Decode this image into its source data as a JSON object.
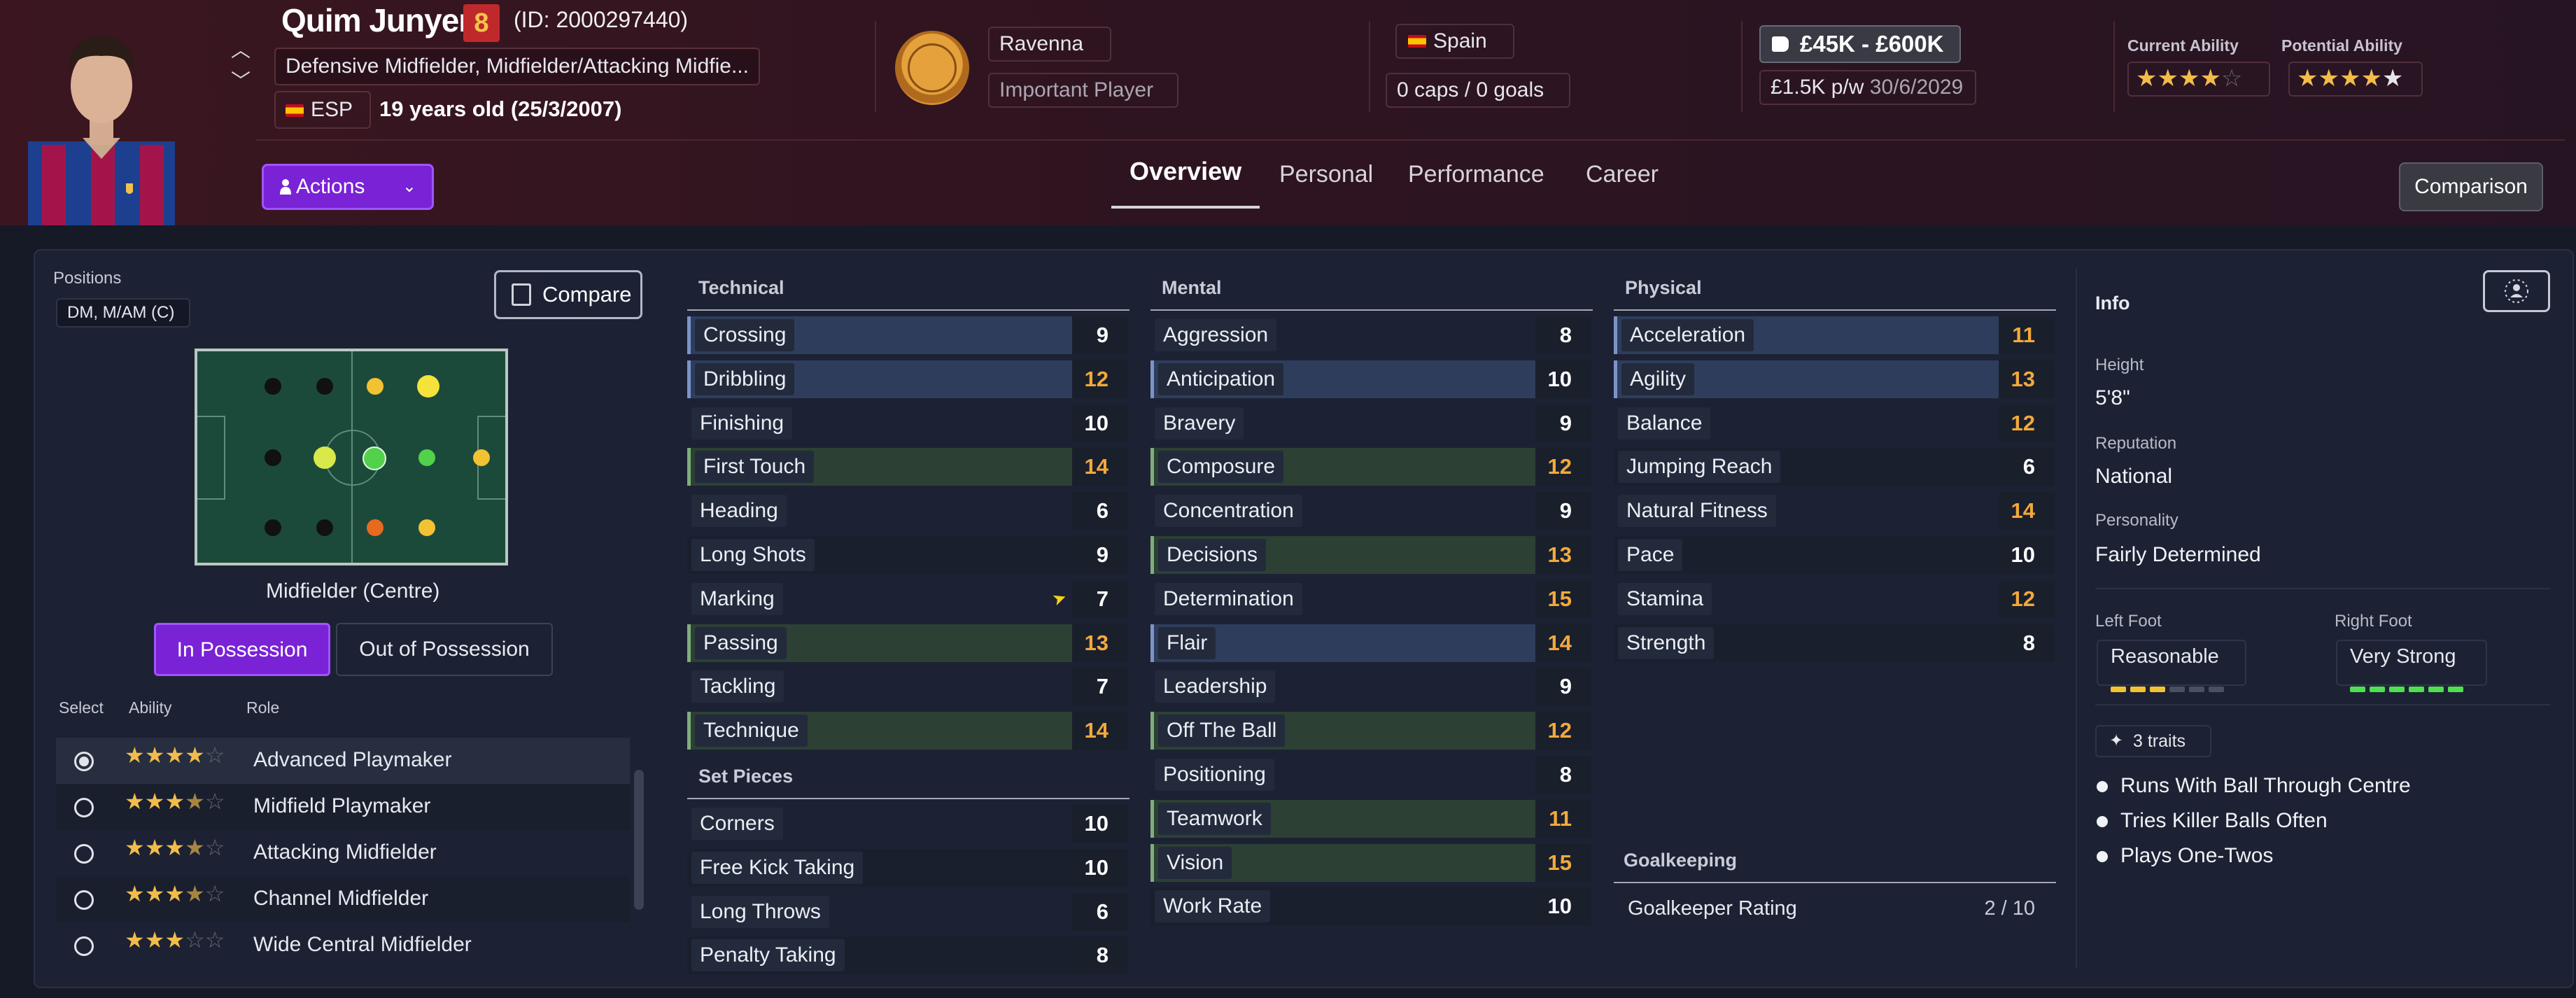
{
  "player": {
    "name": "Quim Junyent",
    "shirt_number": "8",
    "id_text": "(ID: 2000297440)",
    "positions_text": "Defensive Midfielder, Midfielder/Attacking Midfie...",
    "nationality_code": "ESP",
    "age_text": "19 years old (25/3/2007)"
  },
  "club": {
    "name": "Ravenna",
    "squad_status": "Important Player"
  },
  "nation": {
    "name": "Spain",
    "caps_goals": "0 caps / 0 goals"
  },
  "contract": {
    "value_range": "£45K - £600K",
    "wage": "£1.5K p/w",
    "expiry": "30/6/2029"
  },
  "ability": {
    "current_label": "Current Ability",
    "potential_label": "Potential Ability",
    "current_stars": 4,
    "potential_stars": 5
  },
  "actions_label": "Actions",
  "tabs": [
    "Overview",
    "Personal",
    "Performance",
    "Career"
  ],
  "comparison_label": "Comparison",
  "positions_panel": {
    "label": "Positions",
    "chip": "DM, M/AM (C)",
    "compare_label": "Compare",
    "role_title": "Midfielder (Centre)",
    "in_possession": "In Possession",
    "out_of_possession": "Out of Possession",
    "col_select": "Select",
    "col_ability": "Ability",
    "col_role": "Role",
    "roles": [
      {
        "name": "Advanced Playmaker",
        "stars": 4,
        "selected": true
      },
      {
        "name": "Midfield Playmaker",
        "stars": 3.5,
        "selected": false
      },
      {
        "name": "Attacking Midfielder",
        "stars": 3.5,
        "selected": false
      },
      {
        "name": "Channel Midfielder",
        "stars": 3.5,
        "selected": false
      },
      {
        "name": "Wide Central Midfielder",
        "stars": 3,
        "selected": false
      }
    ]
  },
  "technical": {
    "title": "Technical",
    "attributes": [
      {
        "name": "Crossing",
        "value": "9",
        "hl": "blue"
      },
      {
        "name": "Dribbling",
        "value": "12",
        "hl": "blue"
      },
      {
        "name": "Finishing",
        "value": "10",
        "hl": "none"
      },
      {
        "name": "First Touch",
        "value": "14",
        "hl": "green"
      },
      {
        "name": "Heading",
        "value": "6",
        "hl": "none"
      },
      {
        "name": "Long Shots",
        "value": "9",
        "hl": "dark"
      },
      {
        "name": "Marking",
        "value": "7",
        "hl": "none"
      },
      {
        "name": "Passing",
        "value": "13",
        "hl": "green"
      },
      {
        "name": "Tackling",
        "value": "7",
        "hl": "none"
      },
      {
        "name": "Technique",
        "value": "14",
        "hl": "green"
      }
    ]
  },
  "set_pieces": {
    "title": "Set Pieces",
    "attributes": [
      {
        "name": "Corners",
        "value": "10",
        "hl": "none"
      },
      {
        "name": "Free Kick Taking",
        "value": "10",
        "hl": "dark"
      },
      {
        "name": "Long Throws",
        "value": "6",
        "hl": "none"
      },
      {
        "name": "Penalty Taking",
        "value": "8",
        "hl": "dark"
      }
    ]
  },
  "mental": {
    "title": "Mental",
    "attributes": [
      {
        "name": "Aggression",
        "value": "8",
        "hl": "none"
      },
      {
        "name": "Anticipation",
        "value": "10",
        "hl": "blue"
      },
      {
        "name": "Bravery",
        "value": "9",
        "hl": "none"
      },
      {
        "name": "Composure",
        "value": "12",
        "hl": "green"
      },
      {
        "name": "Concentration",
        "value": "9",
        "hl": "none"
      },
      {
        "name": "Decisions",
        "value": "13",
        "hl": "green"
      },
      {
        "name": "Determination",
        "value": "15",
        "hl": "none"
      },
      {
        "name": "Flair",
        "value": "14",
        "hl": "blue"
      },
      {
        "name": "Leadership",
        "value": "9",
        "hl": "none"
      },
      {
        "name": "Off The Ball",
        "value": "12",
        "hl": "green"
      },
      {
        "name": "Positioning",
        "value": "8",
        "hl": "none"
      },
      {
        "name": "Teamwork",
        "value": "11",
        "hl": "green"
      },
      {
        "name": "Vision",
        "value": "15",
        "hl": "green"
      },
      {
        "name": "Work Rate",
        "value": "10",
        "hl": "dark"
      }
    ]
  },
  "physical": {
    "title": "Physical",
    "attributes": [
      {
        "name": "Acceleration",
        "value": "11",
        "hl": "blue"
      },
      {
        "name": "Agility",
        "value": "13",
        "hl": "blue"
      },
      {
        "name": "Balance",
        "value": "12",
        "hl": "none"
      },
      {
        "name": "Jumping Reach",
        "value": "6",
        "hl": "dark"
      },
      {
        "name": "Natural Fitness",
        "value": "14",
        "hl": "none"
      },
      {
        "name": "Pace",
        "value": "10",
        "hl": "dark"
      },
      {
        "name": "Stamina",
        "value": "12",
        "hl": "none"
      },
      {
        "name": "Strength",
        "value": "8",
        "hl": "dark"
      }
    ]
  },
  "goalkeeping": {
    "title": "Goalkeeping",
    "rating_label": "Goalkeeper Rating",
    "rating_value": "2 / 10"
  },
  "info": {
    "title": "Info",
    "height_label": "Height",
    "height": "5'8\"",
    "reputation_label": "Reputation",
    "reputation": "National",
    "personality_label": "Personality",
    "personality": "Fairly Determined",
    "left_foot_label": "Left Foot",
    "left_foot": "Reasonable",
    "left_foot_level": 3,
    "right_foot_label": "Right Foot",
    "right_foot": "Very Strong",
    "right_foot_level": 6,
    "traits_label": "3 traits",
    "traits": [
      "Runs With Ball Through Centre",
      "Tries Killer Balls Often",
      "Plays One-Twos"
    ]
  },
  "colors": {
    "accent_purple": "#7a22d6",
    "value_orange": "#f2a93b",
    "star_gold": "#f2bc4b",
    "foot_yellow": "#f2c233",
    "foot_green": "#4ee04e"
  }
}
